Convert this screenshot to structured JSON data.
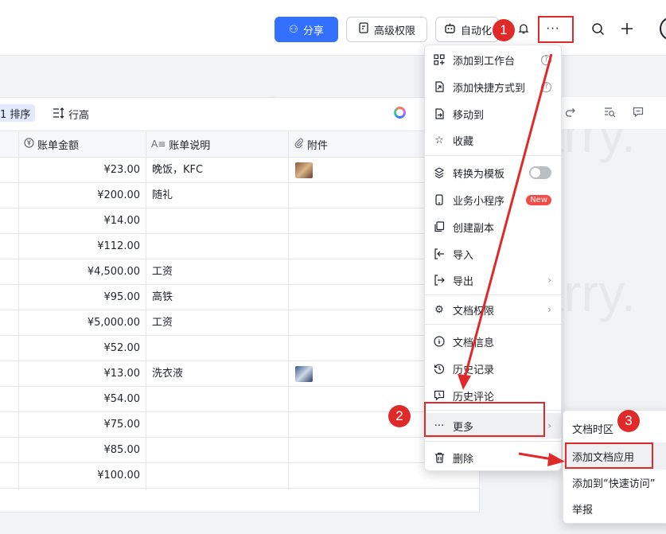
{
  "topbar": {
    "share_label": "分享",
    "permission_label": "高级权限",
    "automation_label": "自动化",
    "more_label": "···"
  },
  "toolbar": {
    "sort_label": "1 排序",
    "row_height_label": "行高"
  },
  "columns": [
    {
      "label": "账单金额",
      "icon": "currency-icon"
    },
    {
      "label": "账单说明",
      "icon": "text-icon"
    },
    {
      "label": "附件",
      "icon": "paperclip-icon"
    }
  ],
  "rows": [
    {
      "amount": "¥23.00",
      "desc": "晚饭，KFC",
      "attachment": true
    },
    {
      "amount": "¥200.00",
      "desc": "随礼",
      "attachment": false
    },
    {
      "amount": "¥14.00",
      "desc": "",
      "attachment": false
    },
    {
      "amount": "¥112.00",
      "desc": "",
      "attachment": false
    },
    {
      "amount": "¥4,500.00",
      "desc": "工资",
      "attachment": false
    },
    {
      "amount": "¥95.00",
      "desc": "高铁",
      "attachment": false
    },
    {
      "amount": "¥5,000.00",
      "desc": "工资",
      "attachment": false
    },
    {
      "amount": "¥52.00",
      "desc": "",
      "attachment": false
    },
    {
      "amount": "¥13.00",
      "desc": "洗衣液",
      "attachment": true
    },
    {
      "amount": "¥54.00",
      "desc": "",
      "attachment": false
    },
    {
      "amount": "¥75.00",
      "desc": "",
      "attachment": false
    },
    {
      "amount": "¥85.00",
      "desc": "",
      "attachment": false
    },
    {
      "amount": "¥100.00",
      "desc": "",
      "attachment": false
    }
  ],
  "menu": {
    "items": [
      {
        "label": "添加到工作台",
        "icon": "grid-plus-icon"
      },
      {
        "label": "添加快捷方式到",
        "icon": "shortcut-icon"
      },
      {
        "label": "移动到",
        "icon": "move-icon"
      },
      {
        "label": "收藏",
        "icon": "star-icon"
      },
      {
        "label": "转换为模板",
        "icon": "template-icon"
      },
      {
        "label": "业务小程序",
        "icon": "phone-icon",
        "badge": "New"
      },
      {
        "label": "创建副本",
        "icon": "copy-icon"
      },
      {
        "label": "导入",
        "icon": "import-icon"
      },
      {
        "label": "导出",
        "icon": "export-icon"
      },
      {
        "label": "文档权限",
        "icon": "gear-icon"
      },
      {
        "label": "文档信息",
        "icon": "info-icon"
      },
      {
        "label": "历史记录",
        "icon": "history-icon"
      },
      {
        "label": "历史评论",
        "icon": "comment-history-icon"
      },
      {
        "label": "更多",
        "icon": "more-icon"
      },
      {
        "label": "删除",
        "icon": "trash-icon"
      }
    ]
  },
  "submenu": {
    "items": [
      {
        "label": "文档时区"
      },
      {
        "label": "添加文档应用"
      },
      {
        "label": "添加到“快速访问”"
      },
      {
        "label": "举报"
      }
    ]
  },
  "annotations": [
    "1",
    "2",
    "3"
  ],
  "watermark": "Larry.",
  "colors": {
    "primary": "#3370ff",
    "annotation": "#e02a2a",
    "badge_new": "#f54a45"
  }
}
